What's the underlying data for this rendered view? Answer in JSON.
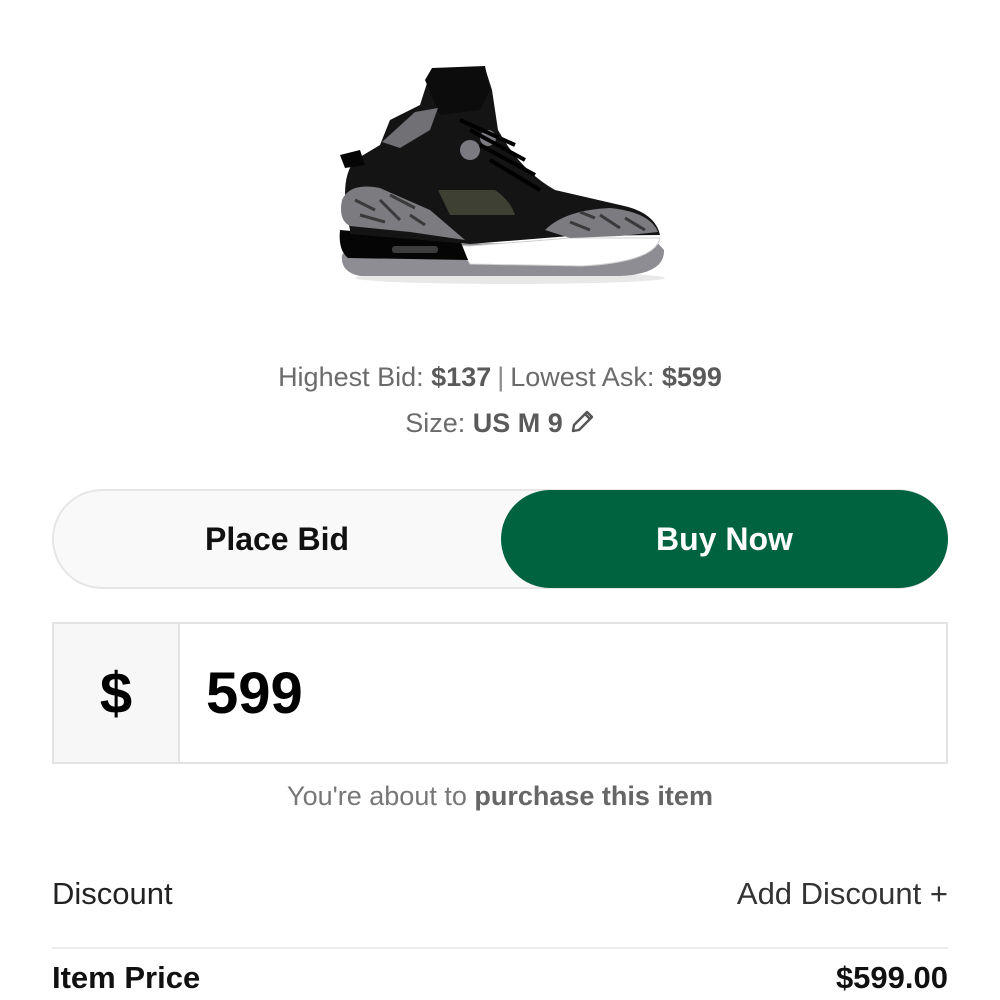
{
  "product": {
    "image_icon": "sneaker-image"
  },
  "market": {
    "highest_bid_label": "Highest Bid:",
    "highest_bid_value": "$137",
    "separator": "|",
    "lowest_ask_label": "Lowest Ask:",
    "lowest_ask_value": "$599",
    "size_label": "Size:",
    "size_value": "US M 9",
    "edit_icon": "pencil-icon"
  },
  "mode_toggle": {
    "place_bid_label": "Place Bid",
    "buy_now_label": "Buy Now",
    "active": "buy_now",
    "active_color": "#006340"
  },
  "price_input": {
    "currency_symbol": "$",
    "value": "599"
  },
  "purchase_note": {
    "prefix": "You're about to",
    "emphasis": "purchase this item"
  },
  "discount": {
    "label": "Discount",
    "action_label": "Add Discount +"
  },
  "item_price": {
    "label": "Item Price",
    "value": "$599.00"
  }
}
